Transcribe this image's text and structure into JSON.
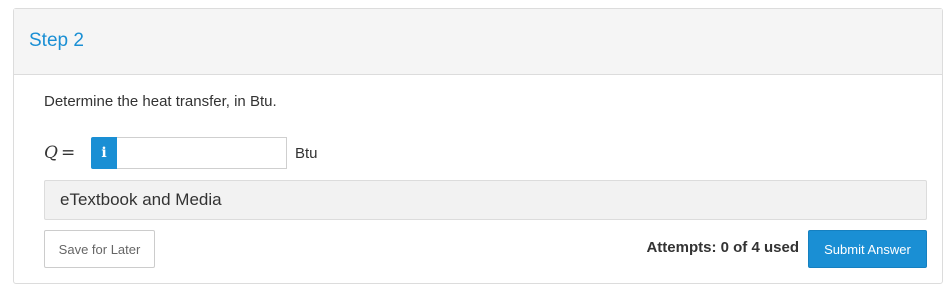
{
  "step": {
    "title": "Step 2"
  },
  "question": {
    "text": "Determine the heat transfer, in Btu."
  },
  "answer": {
    "variable": "Q",
    "equals": "=",
    "info_label": "i",
    "value": "",
    "placeholder": "",
    "unit": "Btu"
  },
  "resources": {
    "etextbook_label": "eTextbook and Media"
  },
  "footer": {
    "save_label": "Save for Later",
    "attempts_text": "Attempts: 0 of 4 used",
    "submit_label": "Submit Answer"
  },
  "colors": {
    "accent": "#1a8fd4",
    "header_bg": "#f5f5f5"
  },
  "icons": {
    "info": "info-icon"
  }
}
